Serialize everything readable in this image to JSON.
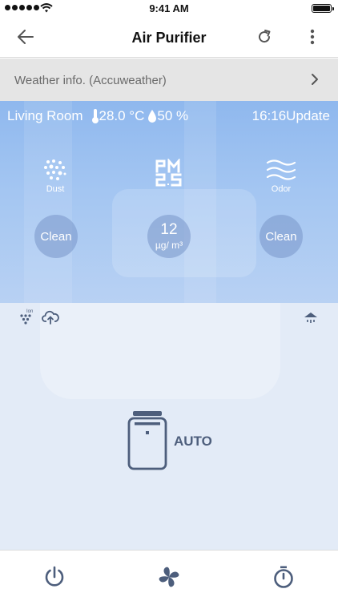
{
  "status_bar": {
    "time": "9:41 AM",
    "signal_icon": "signal-dots-icon",
    "wifi_icon": "wifi-icon",
    "battery_icon": "battery-icon"
  },
  "nav": {
    "title": "Air Purifier",
    "back_icon": "back-arrow-icon",
    "refresh_icon": "refresh-icon",
    "more_icon": "more-vertical-icon"
  },
  "weather": {
    "label": "Weather info. (Accuweather)",
    "chevron_icon": "chevron-right-icon"
  },
  "room": {
    "name": "Living Room",
    "temperature": "28.0 °C",
    "humidity": "50 %",
    "update_time": "16:16Update"
  },
  "sensors": {
    "dust": {
      "label": "Dust",
      "status": "Clean",
      "icon": "dust-icon"
    },
    "pm25": {
      "icon_text_top": "PM",
      "icon_text_bottom": "2.5",
      "value": "12",
      "unit": "µg/ m³"
    },
    "odor": {
      "label": "Odor",
      "status": "Clean",
      "icon": "odor-waves-icon"
    }
  },
  "modes": {
    "ion_label": "Ion",
    "mode": "AUTO"
  },
  "tabs": [
    "power-icon",
    "fan-icon",
    "timer-icon"
  ],
  "colors": {
    "hero_blue": "#9fc2f0",
    "lower_bg": "#e3ebf7",
    "icon_dark": "#4d5e7c"
  }
}
